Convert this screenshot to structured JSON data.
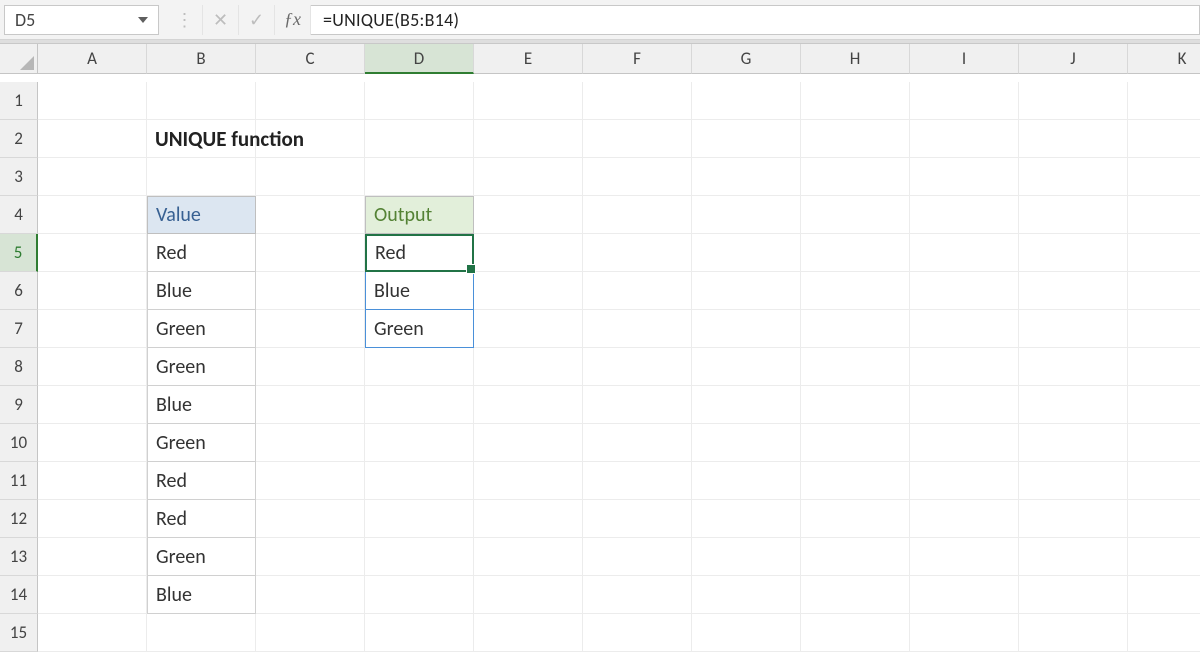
{
  "nameBox": "D5",
  "formula": "=UNIQUE(B5:B14)",
  "columns": [
    "A",
    "B",
    "C",
    "D",
    "E",
    "F",
    "G",
    "H",
    "I",
    "J",
    "K"
  ],
  "selectedCol": "D",
  "rows": [
    "1",
    "2",
    "3",
    "4",
    "5",
    "6",
    "7",
    "8",
    "9",
    "10",
    "11",
    "12",
    "13",
    "14",
    "15"
  ],
  "selectedRow": "5",
  "title": "UNIQUE function",
  "valueHeader": "Value",
  "outputHeader": "Output",
  "values": [
    "Red",
    "Blue",
    "Green",
    "Green",
    "Blue",
    "Green",
    "Red",
    "Red",
    "Green",
    "Blue"
  ],
  "output": [
    "Red",
    "Blue",
    "Green"
  ]
}
